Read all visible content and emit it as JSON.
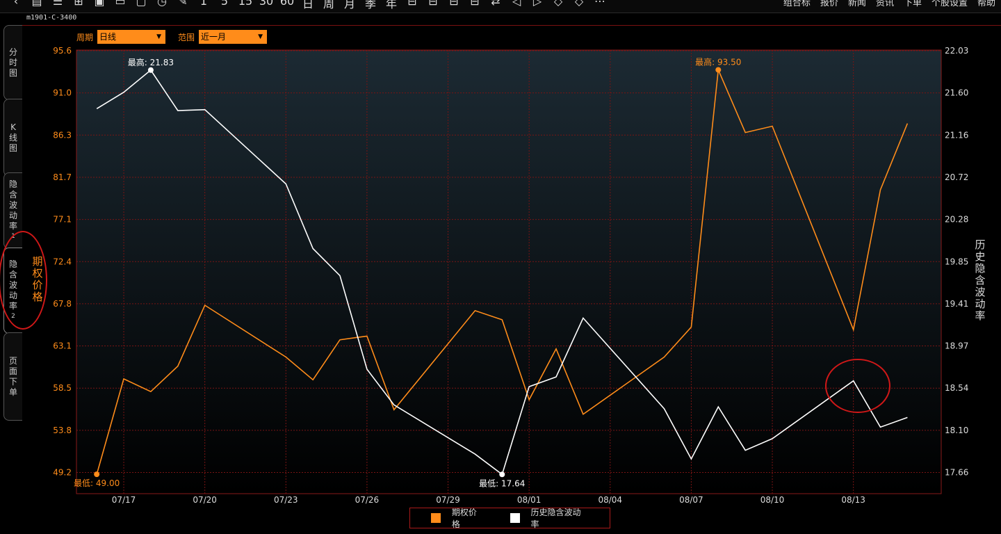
{
  "toolbar": {
    "icons": [
      "back-icon",
      "grid-icon",
      "list-icon",
      "candle-icon",
      "indicator-icon",
      "layout-icon",
      "window-icon",
      "clock-icon",
      "draw-icon",
      "min1",
      "min5",
      "min15",
      "min30",
      "min60",
      "day",
      "week",
      "month",
      "quarter",
      "year",
      "multi1",
      "multi2",
      "multi3",
      "multi4",
      "compare-icon",
      "prev-icon",
      "next-icon",
      "zoom-in-icon",
      "zoom-out-icon",
      "more-icon"
    ],
    "right_items": [
      "组合标",
      "报价",
      "新闻",
      "资讯",
      "下单",
      "个股设置",
      "帮助"
    ]
  },
  "contract": "m1901-C-3400",
  "side_tabs": [
    {
      "label": "分时图"
    },
    {
      "label": "K线图"
    },
    {
      "label": "隐含波动率1"
    },
    {
      "label": "隐含波动率2"
    },
    {
      "label": "页面下单"
    }
  ],
  "selectors": {
    "period_label": "周期",
    "period_value": "日线",
    "range_label": "范围",
    "range_value": "近一月"
  },
  "legend": [
    {
      "name": "期权价格",
      "color": "#ff8c1a"
    },
    {
      "name": "历史隐含波动率",
      "color": "#ffffff"
    }
  ],
  "chart_data": {
    "type": "line",
    "y_left_label": "期权价格",
    "y_right_label": "历史隐含波动率",
    "y_left_ticks": [
      "95.6",
      "91.0",
      "86.3",
      "81.7",
      "77.1",
      "72.4",
      "67.8",
      "63.1",
      "58.5",
      "53.8",
      "49.2"
    ],
    "y_right_ticks": [
      "22.03",
      "21.60",
      "21.16",
      "20.72",
      "20.28",
      "19.85",
      "19.41",
      "18.97",
      "18.54",
      "18.10",
      "17.66"
    ],
    "y_left_range": [
      49.2,
      95.6
    ],
    "y_right_range": [
      17.66,
      22.03
    ],
    "x_ticks": [
      "07/17",
      "07/20",
      "07/23",
      "07/26",
      "07/29",
      "08/01",
      "08/04",
      "08/07",
      "08/10",
      "08/13"
    ],
    "x_tick_days": [
      1,
      4,
      7,
      10,
      13,
      16,
      19,
      22,
      25,
      28
    ],
    "x_range_days": [
      -0.75,
      31.25
    ],
    "series": [
      {
        "name": "期权价格",
        "axis": "left",
        "color": "#ff8c1a",
        "days": [
          0,
          1,
          2,
          3,
          4,
          7,
          8,
          9,
          10,
          11,
          14,
          15,
          16,
          17,
          18,
          21,
          22,
          23,
          24,
          25,
          28,
          29,
          30
        ],
        "values": [
          49.0,
          59.5,
          58.1,
          60.9,
          67.6,
          61.9,
          59.4,
          63.8,
          64.2,
          56.1,
          67.0,
          66.0,
          57.2,
          62.8,
          55.6,
          61.9,
          65.2,
          93.5,
          86.6,
          87.3,
          64.9,
          80.3,
          87.6
        ]
      },
      {
        "name": "历史隐含波动率",
        "axis": "right",
        "color": "#ffffff",
        "days": [
          0,
          1,
          2,
          3,
          4,
          7,
          8,
          9,
          10,
          11,
          14,
          15,
          16,
          17,
          18,
          21,
          22,
          23,
          24,
          25,
          28,
          29,
          30
        ],
        "values": [
          21.43,
          21.6,
          21.83,
          21.41,
          21.42,
          20.65,
          19.98,
          19.7,
          18.73,
          18.36,
          17.85,
          17.64,
          18.55,
          18.65,
          19.26,
          18.32,
          17.8,
          18.34,
          17.89,
          18.01,
          18.61,
          18.13,
          18.23
        ]
      }
    ],
    "annotations": [
      {
        "series": 0,
        "index": 17,
        "label": "最高: 93.50"
      },
      {
        "series": 0,
        "index": 0,
        "label": "最低: 49.00"
      },
      {
        "series": 1,
        "index": 2,
        "label": "最高: 21.83"
      },
      {
        "series": 1,
        "index": 11,
        "label": "最低: 17.64"
      }
    ],
    "grid": true,
    "legend_position": "bottom-center"
  }
}
